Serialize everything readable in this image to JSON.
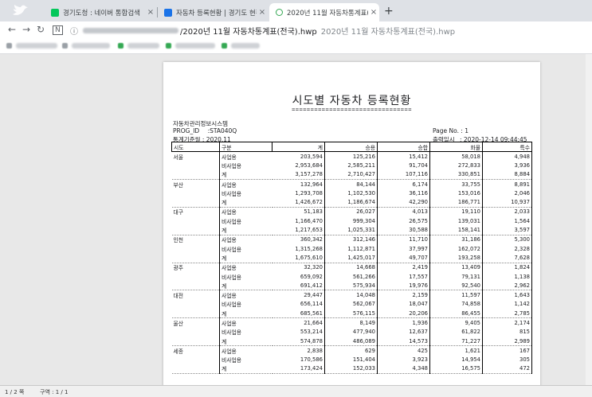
{
  "browser": {
    "tabs": [
      {
        "title": "경기도청 : 네이버 통합검색",
        "icon_color": "#03c75a"
      },
      {
        "title": "자동차 등록현황 | 경기도 현황",
        "icon_color": "#1a73e8"
      },
      {
        "title": "2020년 11월 자동차통계표(전국",
        "icon_color": "#34a853"
      }
    ],
    "close_glyph": "×",
    "new_tab_glyph": "+",
    "nav": {
      "back": "←",
      "forward": "→",
      "reload": "↻",
      "home": "N"
    },
    "url_visible": "/2020년 11월 자동차통계표(전국).hwp",
    "url_suffix": "2020년 11월 자동차통계표(전국).hwp",
    "info_glyph": "ⓘ"
  },
  "report": {
    "title": "시도별 자동차 등록현황",
    "equals_line": "================================",
    "system": "자동차관리정보시스템",
    "prog_label": "PROG_ID",
    "prog_value": ":STA040Q",
    "period_label": "통계기준월",
    "period_value": ": 2020.11",
    "page_label": "Page  No.",
    "page_value": ": 1",
    "printed_label": "출력일시",
    "printed_value": ": 2020-12-14 09:44:45",
    "headers": [
      "시도",
      "구분",
      "계",
      "승용",
      "승합",
      "화물",
      "특수"
    ],
    "regions": [
      {
        "name": "서울",
        "rows": [
          {
            "cat": "사업용",
            "v": [
              "203,594",
              "125,216",
              "15,412",
              "58,018",
              "4,948"
            ]
          },
          {
            "cat": "비사업용",
            "v": [
              "2,953,684",
              "2,585,211",
              "91,704",
              "272,833",
              "3,936"
            ]
          },
          {
            "cat": "계",
            "v": [
              "3,157,278",
              "2,710,427",
              "107,116",
              "330,851",
              "8,884"
            ]
          }
        ]
      },
      {
        "name": "부산",
        "rows": [
          {
            "cat": "사업용",
            "v": [
              "132,964",
              "84,144",
              "6,174",
              "33,755",
              "8,891"
            ]
          },
          {
            "cat": "비사업용",
            "v": [
              "1,293,708",
              "1,102,530",
              "36,116",
              "153,016",
              "2,046"
            ]
          },
          {
            "cat": "계",
            "v": [
              "1,426,672",
              "1,186,674",
              "42,290",
              "186,771",
              "10,937"
            ]
          }
        ]
      },
      {
        "name": "대구",
        "rows": [
          {
            "cat": "사업용",
            "v": [
              "51,183",
              "26,027",
              "4,013",
              "19,110",
              "2,033"
            ]
          },
          {
            "cat": "비사업용",
            "v": [
              "1,166,470",
              "999,304",
              "26,575",
              "139,031",
              "1,564"
            ]
          },
          {
            "cat": "계",
            "v": [
              "1,217,653",
              "1,025,331",
              "30,588",
              "158,141",
              "3,597"
            ]
          }
        ]
      },
      {
        "name": "인천",
        "rows": [
          {
            "cat": "사업용",
            "v": [
              "360,342",
              "312,146",
              "11,710",
              "31,186",
              "5,300"
            ]
          },
          {
            "cat": "비사업용",
            "v": [
              "1,315,268",
              "1,112,871",
              "37,997",
              "162,072",
              "2,328"
            ]
          },
          {
            "cat": "계",
            "v": [
              "1,675,610",
              "1,425,017",
              "49,707",
              "193,258",
              "7,628"
            ]
          }
        ]
      },
      {
        "name": "광주",
        "rows": [
          {
            "cat": "사업용",
            "v": [
              "32,320",
              "14,668",
              "2,419",
              "13,409",
              "1,824"
            ]
          },
          {
            "cat": "비사업용",
            "v": [
              "659,092",
              "561,266",
              "17,557",
              "79,131",
              "1,138"
            ]
          },
          {
            "cat": "계",
            "v": [
              "691,412",
              "575,934",
              "19,976",
              "92,540",
              "2,962"
            ]
          }
        ]
      },
      {
        "name": "대전",
        "rows": [
          {
            "cat": "사업용",
            "v": [
              "29,447",
              "14,048",
              "2,159",
              "11,597",
              "1,643"
            ]
          },
          {
            "cat": "비사업용",
            "v": [
              "656,114",
              "562,067",
              "18,047",
              "74,858",
              "1,142"
            ]
          },
          {
            "cat": "계",
            "v": [
              "685,561",
              "576,115",
              "20,206",
              "86,455",
              "2,785"
            ]
          }
        ]
      },
      {
        "name": "울산",
        "rows": [
          {
            "cat": "사업용",
            "v": [
              "21,664",
              "8,149",
              "1,936",
              "9,405",
              "2,174"
            ]
          },
          {
            "cat": "비사업용",
            "v": [
              "553,214",
              "477,940",
              "12,637",
              "61,822",
              "815"
            ]
          },
          {
            "cat": "계",
            "v": [
              "574,878",
              "486,089",
              "14,573",
              "71,227",
              "2,989"
            ]
          }
        ]
      },
      {
        "name": "세종",
        "rows": [
          {
            "cat": "사업용",
            "v": [
              "2,838",
              "629",
              "425",
              "1,621",
              "167"
            ]
          },
          {
            "cat": "비사업용",
            "v": [
              "170,586",
              "151,404",
              "3,923",
              "14,954",
              "305"
            ]
          },
          {
            "cat": "계",
            "v": [
              "173,424",
              "152,033",
              "4,348",
              "16,575",
              "472"
            ]
          }
        ]
      }
    ]
  },
  "status": {
    "page": "1 / 2 쪽",
    "section": "구역 : 1 / 1"
  }
}
